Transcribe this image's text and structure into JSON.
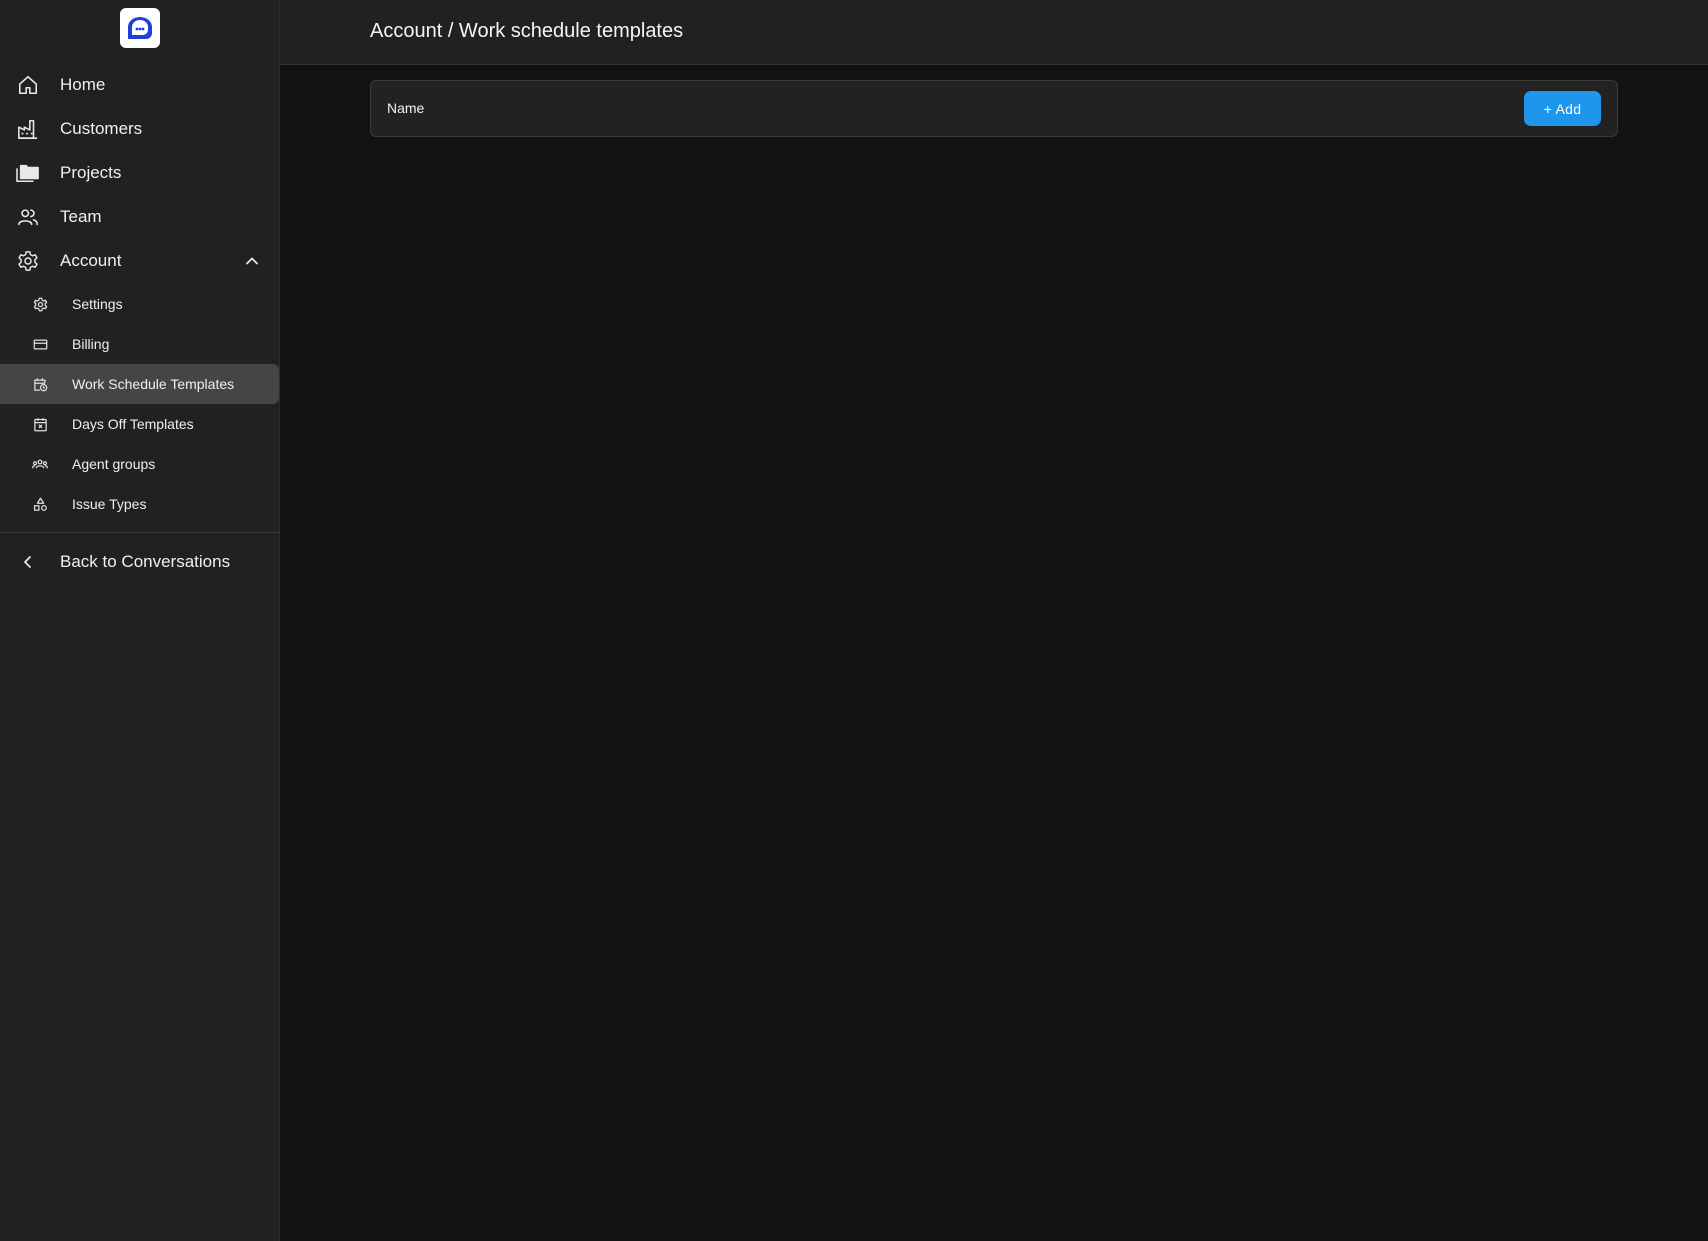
{
  "breadcrumb": "Account / Work schedule templates",
  "sidebar": {
    "logo_icon": "chat-bubble-logo-icon",
    "items": [
      {
        "label": "Home",
        "icon": "home-icon"
      },
      {
        "label": "Customers",
        "icon": "factory-icon"
      },
      {
        "label": "Projects",
        "icon": "folders-icon"
      },
      {
        "label": "Team",
        "icon": "users-icon"
      },
      {
        "label": "Account",
        "icon": "gear-icon",
        "expanded": true
      }
    ],
    "sub_items": [
      {
        "label": "Settings",
        "icon": "settings-icon"
      },
      {
        "label": "Billing",
        "icon": "card-icon"
      },
      {
        "label": "Work Schedule Templates",
        "icon": "calendar-clock-icon",
        "active": true
      },
      {
        "label": "Days Off Templates",
        "icon": "calendar-x-icon"
      },
      {
        "label": "Agent groups",
        "icon": "group-icon"
      },
      {
        "label": "Issue Types",
        "icon": "shapes-icon"
      }
    ],
    "back_label": "Back to Conversations"
  },
  "table": {
    "column_name": "Name",
    "add_label": "+ Add"
  },
  "colors": {
    "accent": "#1e96ec",
    "sidebar_bg": "#212121",
    "main_bg": "#121212",
    "active_item_bg": "#454545",
    "logo_blue": "#1f3fd6"
  }
}
